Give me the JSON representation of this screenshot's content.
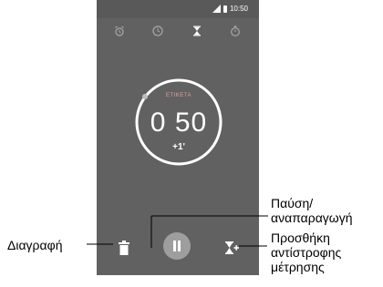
{
  "status_bar": {
    "time": "10:50"
  },
  "tabs": [
    {
      "name": "alarm",
      "icon": "alarm-clock-icon"
    },
    {
      "name": "clock",
      "icon": "clock-icon"
    },
    {
      "name": "timer",
      "icon": "hourglass-icon",
      "active": true
    },
    {
      "name": "stopwatch",
      "icon": "stopwatch-icon"
    }
  ],
  "timer": {
    "label": "ΕΤΙΚΕΤΑ",
    "time": "0 50",
    "add_minute": "+1'"
  },
  "callouts": {
    "pause_play_line1": "Παύση/",
    "pause_play_line2": "αναπαραγωγή",
    "add_timer_line1": "Προσθήκη",
    "add_timer_line2": "αντίστροφης",
    "add_timer_line3": "μέτρησης",
    "delete": "Διαγραφή"
  },
  "colors": {
    "screen_bg": "#616161",
    "ring": "#ffffff",
    "ring_marker": "#bdbdbd",
    "label": "#e0a0a0"
  }
}
